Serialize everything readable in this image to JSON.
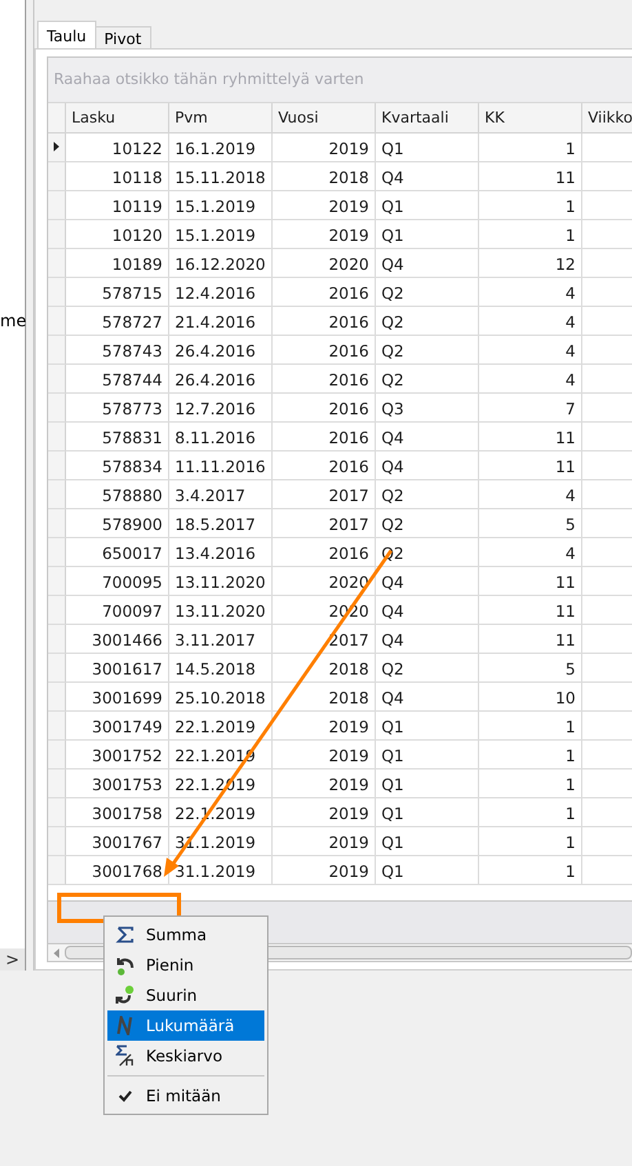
{
  "side_panel": {
    "label": "me",
    "expand_button": ">"
  },
  "tabs": [
    {
      "label": "Taulu",
      "selected": true
    },
    {
      "label": "Pivot",
      "selected": false
    }
  ],
  "group_panel": {
    "placeholder": "Raahaa otsikko tähän ryhmittelyä varten"
  },
  "table": {
    "columns": [
      {
        "label": "Lasku"
      },
      {
        "label": "Pvm"
      },
      {
        "label": "Vuosi"
      },
      {
        "label": "Kvartaali"
      },
      {
        "label": "KK"
      },
      {
        "label": "Viikko"
      }
    ],
    "rows": [
      {
        "selected": true,
        "cells": [
          "10122",
          "16.1.2019",
          "2019",
          "Q1",
          "1"
        ]
      },
      {
        "selected": false,
        "cells": [
          "10118",
          "15.11.2018",
          "2018",
          "Q4",
          "11"
        ]
      },
      {
        "selected": false,
        "cells": [
          "10119",
          "15.1.2019",
          "2019",
          "Q1",
          "1"
        ]
      },
      {
        "selected": false,
        "cells": [
          "10120",
          "15.1.2019",
          "2019",
          "Q1",
          "1"
        ]
      },
      {
        "selected": false,
        "cells": [
          "10189",
          "16.12.2020",
          "2020",
          "Q4",
          "12"
        ]
      },
      {
        "selected": false,
        "cells": [
          "578715",
          "12.4.2016",
          "2016",
          "Q2",
          "4"
        ]
      },
      {
        "selected": false,
        "cells": [
          "578727",
          "21.4.2016",
          "2016",
          "Q2",
          "4"
        ]
      },
      {
        "selected": false,
        "cells": [
          "578743",
          "26.4.2016",
          "2016",
          "Q2",
          "4"
        ]
      },
      {
        "selected": false,
        "cells": [
          "578744",
          "26.4.2016",
          "2016",
          "Q2",
          "4"
        ]
      },
      {
        "selected": false,
        "cells": [
          "578773",
          "12.7.2016",
          "2016",
          "Q3",
          "7"
        ]
      },
      {
        "selected": false,
        "cells": [
          "578831",
          "8.11.2016",
          "2016",
          "Q4",
          "11"
        ]
      },
      {
        "selected": false,
        "cells": [
          "578834",
          "11.11.2016",
          "2016",
          "Q4",
          "11"
        ]
      },
      {
        "selected": false,
        "cells": [
          "578880",
          "3.4.2017",
          "2017",
          "Q2",
          "4"
        ]
      },
      {
        "selected": false,
        "cells": [
          "578900",
          "18.5.2017",
          "2017",
          "Q2",
          "5"
        ]
      },
      {
        "selected": false,
        "cells": [
          "650017",
          "13.4.2016",
          "2016",
          "Q2",
          "4"
        ]
      },
      {
        "selected": false,
        "cells": [
          "700095",
          "13.11.2020",
          "2020",
          "Q4",
          "11"
        ]
      },
      {
        "selected": false,
        "cells": [
          "700097",
          "13.11.2020",
          "2020",
          "Q4",
          "11"
        ]
      },
      {
        "selected": false,
        "cells": [
          "3001466",
          "3.11.2017",
          "2017",
          "Q4",
          "11"
        ]
      },
      {
        "selected": false,
        "cells": [
          "3001617",
          "14.5.2018",
          "2018",
          "Q2",
          "5"
        ]
      },
      {
        "selected": false,
        "cells": [
          "3001699",
          "25.10.2018",
          "2018",
          "Q4",
          "10"
        ]
      },
      {
        "selected": false,
        "cells": [
          "3001749",
          "22.1.2019",
          "2019",
          "Q1",
          "1"
        ]
      },
      {
        "selected": false,
        "cells": [
          "3001752",
          "22.1.2019",
          "2019",
          "Q1",
          "1"
        ]
      },
      {
        "selected": false,
        "cells": [
          "3001753",
          "22.1.2019",
          "2019",
          "Q1",
          "1"
        ]
      },
      {
        "selected": false,
        "cells": [
          "3001758",
          "22.1.2019",
          "2019",
          "Q1",
          "1"
        ]
      },
      {
        "selected": false,
        "cells": [
          "3001767",
          "31.1.2019",
          "2019",
          "Q1",
          "1"
        ]
      },
      {
        "selected": false,
        "cells": [
          "3001768",
          "31.1.2019",
          "2019",
          "Q1",
          "1"
        ]
      }
    ]
  },
  "context_menu": {
    "items": [
      {
        "kind": "sum",
        "label": "Summa",
        "selected": false
      },
      {
        "kind": "min",
        "label": "Pienin",
        "selected": false
      },
      {
        "kind": "max",
        "label": "Suurin",
        "selected": false
      },
      {
        "kind": "count",
        "label": "Lukumäärä",
        "selected": true
      },
      {
        "kind": "average",
        "label": "Keskiarvo",
        "selected": false
      }
    ],
    "none_item": {
      "label": "Ei mitään",
      "checked": true
    }
  }
}
